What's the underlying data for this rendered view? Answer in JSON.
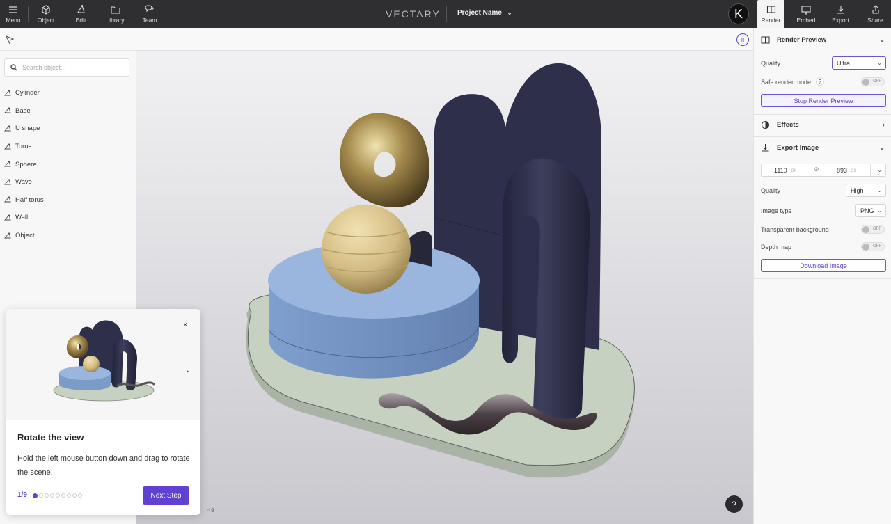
{
  "topbar": {
    "menu_label": "Menu",
    "object_label": "Object",
    "edit_label": "Edit",
    "library_label": "Library",
    "team_label": "Team",
    "logo_text": "VECTARY",
    "project_name": "Project Name",
    "avatar_letter": "K",
    "render_label": "Render",
    "embed_label": "Embed",
    "export_label": "Export",
    "share_label": "Share"
  },
  "sidebar": {
    "search_placeholder": "Search object...",
    "objects": [
      {
        "label": "Cylinder"
      },
      {
        "label": "Base"
      },
      {
        "label": "U shape"
      },
      {
        "label": "Torus"
      },
      {
        "label": "Sphere"
      },
      {
        "label": "Wave"
      },
      {
        "label": "Half torus"
      },
      {
        "label": "Wall"
      },
      {
        "label": "Object"
      }
    ]
  },
  "right_panel": {
    "render_preview_title": "Render Preview",
    "quality_label": "Quality",
    "quality_value": "Ultra",
    "safe_mode_label": "Safe render mode",
    "safe_mode_help": "?",
    "toggle_off": "OFF",
    "stop_button": "Stop Render Preview",
    "effects_title": "Effects",
    "export_title": "Export Image",
    "width_value": "1110",
    "height_value": "893",
    "px_unit": "px",
    "export_quality_label": "Quality",
    "export_quality_value": "High",
    "image_type_label": "Image type",
    "image_type_value": "PNG",
    "transparent_label": "Transparent background",
    "depth_label": "Depth map",
    "download_button": "Download Image"
  },
  "tour": {
    "title": "Rotate the view",
    "text": "Hold the left mouse button down and drag to rotate the scene.",
    "step": "1/9",
    "current_step": 1,
    "total_steps": 9,
    "next_button": "Next Step",
    "close_symbol": "×",
    "arrow_symbol": "▸"
  },
  "viewport": {
    "help_symbol": "?",
    "pause_symbol": "II",
    "object_count": "9"
  },
  "colors": {
    "accent": "#5b46c9",
    "topbar_bg": "#2f2f31",
    "navy": "#2e2f4a",
    "blue_cylinder": "#7c9cc8",
    "sage_base": "#c7d1c2",
    "gold": "#a58a4c",
    "sand": "#d8c38f"
  }
}
